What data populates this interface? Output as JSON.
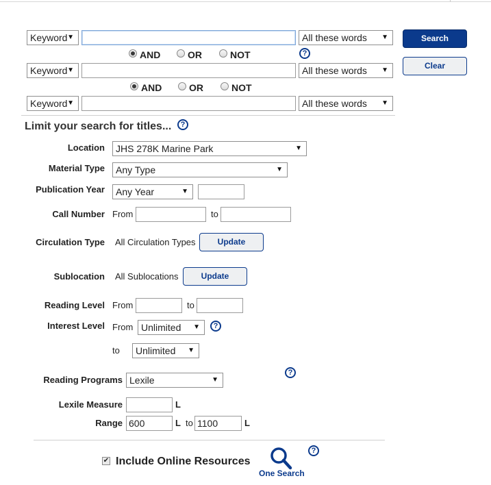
{
  "search_rows": [
    {
      "field": "Keyword",
      "query": "",
      "match": "All these words"
    },
    {
      "field": "Keyword",
      "query": "",
      "match": "All these words"
    },
    {
      "field": "Keyword",
      "query": "",
      "match": "All these words"
    }
  ],
  "operators": [
    {
      "options": [
        "AND",
        "OR",
        "NOT"
      ],
      "selected": "AND"
    },
    {
      "options": [
        "AND",
        "OR",
        "NOT"
      ],
      "selected": "AND"
    }
  ],
  "buttons": {
    "search": "Search",
    "clear": "Clear",
    "update": "Update"
  },
  "help_glyph": "?",
  "limit_heading": "Limit your search for titles...",
  "limits": {
    "location": {
      "label": "Location",
      "value": "JHS 278K Marine Park"
    },
    "material_type": {
      "label": "Material Type",
      "value": "Any Type"
    },
    "publication_year": {
      "label": "Publication Year",
      "value": "Any Year",
      "year": ""
    },
    "call_number": {
      "label": "Call Number",
      "from_label": "From",
      "to_label": "to",
      "from": "",
      "to": ""
    },
    "circulation_type": {
      "label": "Circulation Type",
      "value": "All Circulation Types"
    },
    "sublocation": {
      "label": "Sublocation",
      "value": "All Sublocations"
    },
    "reading_level": {
      "label": "Reading Level",
      "from_label": "From",
      "to_label": "to",
      "from": "",
      "to": ""
    },
    "interest_level": {
      "label": "Interest Level",
      "from_label": "From",
      "to_label": "to",
      "from": "Unlimited",
      "to": "Unlimited"
    },
    "reading_programs": {
      "label": "Reading Programs",
      "value": "Lexile"
    },
    "lexile_measure": {
      "label": "Lexile Measure",
      "value": "",
      "unit": "L"
    },
    "range": {
      "label": "Range",
      "from": "600",
      "to": "1100",
      "unit": "L",
      "to_label": "to"
    }
  },
  "online_resources": {
    "label": "Include Online Resources",
    "checked": true
  },
  "one_search": {
    "label": "One Search"
  },
  "colors": {
    "accent": "#0b3a8c"
  }
}
